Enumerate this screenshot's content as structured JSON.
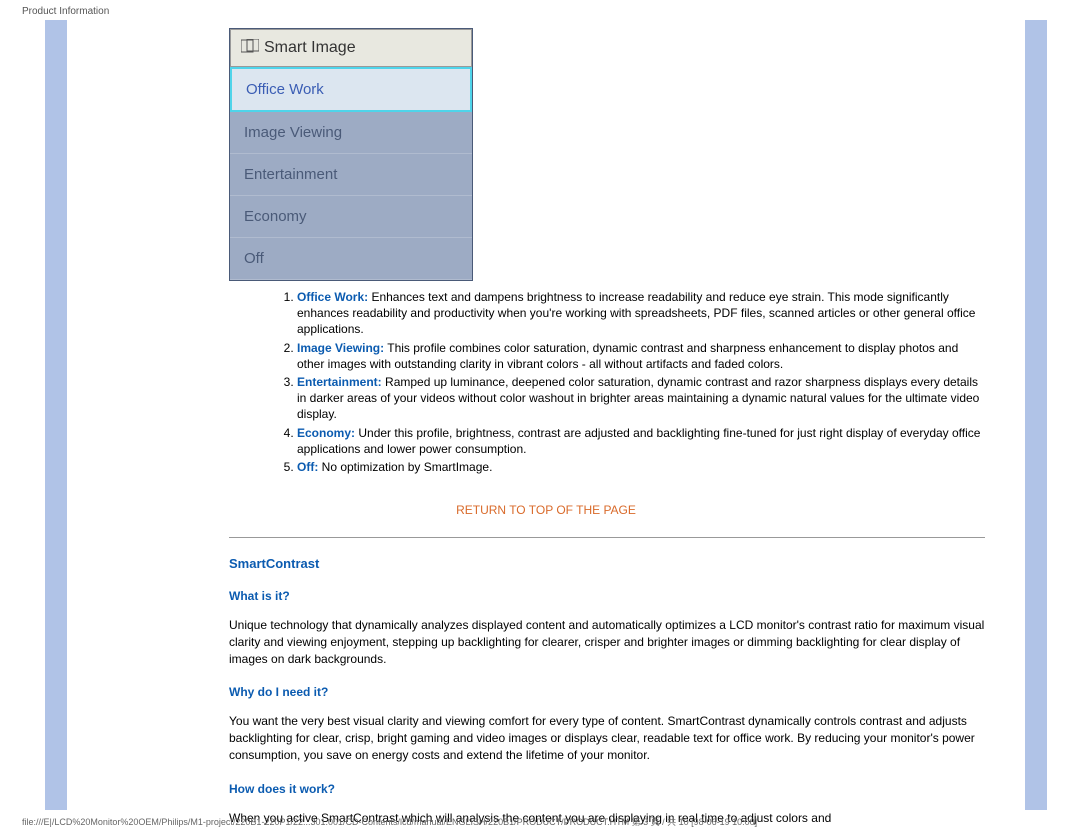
{
  "header": {
    "title": "Product Information"
  },
  "osd": {
    "title": "Smart Image",
    "items": [
      {
        "label": "Office Work",
        "selected": true
      },
      {
        "label": "Image Viewing",
        "selected": false
      },
      {
        "label": "Entertainment",
        "selected": false
      },
      {
        "label": "Economy",
        "selected": false
      },
      {
        "label": "Off",
        "selected": false
      }
    ]
  },
  "modes": [
    {
      "term": "Office Work:",
      "desc": " Enhances text and dampens brightness to increase readability and reduce eye strain. This mode significantly enhances readability and productivity when you're working with spreadsheets, PDF files, scanned articles or other general office applications."
    },
    {
      "term": "Image Viewing:",
      "desc": " This profile combines color saturation, dynamic contrast and sharpness enhancement to display photos and other images with outstanding clarity in vibrant colors - all without artifacts and faded colors."
    },
    {
      "term": "Entertainment:",
      "desc": " Ramped up luminance, deepened color saturation, dynamic contrast and razor sharpness displays every details in darker areas of your videos without color washout in brighter areas maintaining a dynamic natural values for the ultimate video display."
    },
    {
      "term": "Economy:",
      "desc": " Under this profile, brightness, contrast are adjusted and backlighting fine-tuned for just right display of everyday office applications and lower power consumption."
    },
    {
      "term": "Off:",
      "desc": " No optimization by SmartImage."
    }
  ],
  "links": {
    "return_top": "RETURN TO TOP OF THE PAGE"
  },
  "smartcontrast": {
    "title": "SmartContrast",
    "q1": "What is it?",
    "a1": "Unique technology that dynamically analyzes displayed content and automatically optimizes a LCD monitor's contrast ratio for maximum visual clarity and viewing enjoyment, stepping up backlighting for clearer, crisper and brighter images or dimming backlighting for clear display of images on dark backgrounds.",
    "q2": "Why do I need it?",
    "a2": "You want the very best visual clarity and viewing comfort for every type of content. SmartContrast dynamically controls contrast and adjusts backlighting for clear, crisp, bright gaming and video images or displays clear, readable text for office work. By reducing your monitor's power consumption, you save on energy costs and extend the lifetime of your monitor.",
    "q3": "How does it work?",
    "a3": "When you active SmartContrast which will analysis the content you are displaying in real time to adjust colors and"
  },
  "footer": {
    "path": "file:///E|/LCD%20Monitor%20OEM/Philips/M1-project/220B1-220P1/22...301.001/CD-Contents/lcd/manual/ENGLISH/220B1/PRODUCT/PRODUCT.HTM 第 3 頁 / 共 10 [98-06-19 10:00]"
  }
}
